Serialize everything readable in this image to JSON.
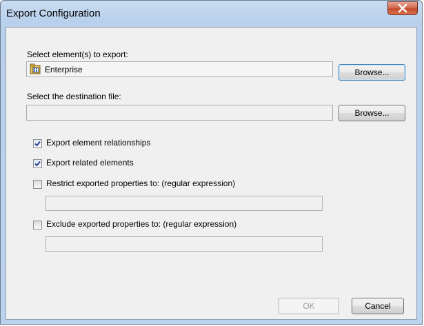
{
  "window": {
    "title": "Export Configuration"
  },
  "elements_section": {
    "label": "Select element(s) to export:",
    "value": "Enterprise",
    "icon": "enterprise-folder-icon",
    "browse_label": "Browse..."
  },
  "destination_section": {
    "label": "Select the destination file:",
    "value": "",
    "browse_label": "Browse..."
  },
  "options": [
    {
      "label": "Export element relationships",
      "checked": true
    },
    {
      "label": "Export related elements",
      "checked": true
    },
    {
      "label": "Restrict exported properties to: (regular expression)",
      "checked": false,
      "field_value": ""
    },
    {
      "label": "Exclude exported properties to: (regular expression)",
      "checked": false,
      "field_value": ""
    }
  ],
  "footer": {
    "ok_label": "OK",
    "ok_enabled": false,
    "cancel_label": "Cancel"
  },
  "colors": {
    "close_button": "#c44a2c",
    "focus_border": "#3c7fb1"
  }
}
